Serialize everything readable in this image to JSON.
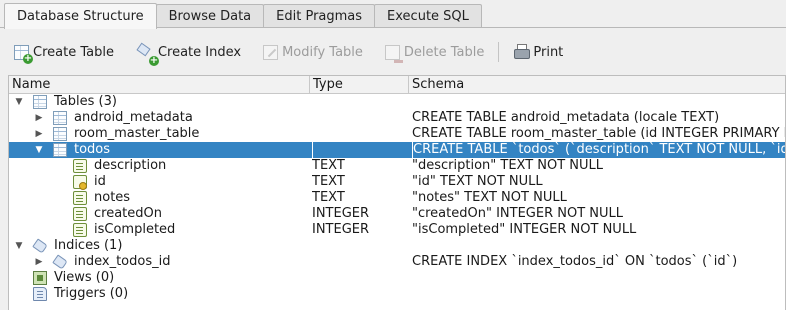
{
  "tabs": [
    {
      "label": "Database Structure",
      "active": true
    },
    {
      "label": "Browse Data",
      "active": false
    },
    {
      "label": "Edit Pragmas",
      "active": false
    },
    {
      "label": "Execute SQL",
      "active": false
    }
  ],
  "toolbar": {
    "create_table": "Create Table",
    "create_index": "Create Index",
    "modify_table": "Modify Table",
    "delete_table": "Delete Table",
    "print": "Print"
  },
  "columns": {
    "name": "Name",
    "type": "Type",
    "schema": "Schema"
  },
  "tree": {
    "tables": {
      "label": "Tables (3)"
    },
    "android_metadata": {
      "name": "android_metadata",
      "schema": "CREATE TABLE android_metadata (locale TEXT)"
    },
    "room_master_table": {
      "name": "room_master_table",
      "schema": "CREATE TABLE room_master_table (id INTEGER PRIMARY KEY,identity_hash TEXT)"
    },
    "todos": {
      "name": "todos",
      "schema": "CREATE TABLE `todos` (`description` TEXT NOT NULL, `id` TEXT NOT NULL"
    },
    "fields": [
      {
        "name": "description",
        "type": "TEXT",
        "schema": "\"description\" TEXT NOT NULL",
        "key": false
      },
      {
        "name": "id",
        "type": "TEXT",
        "schema": "\"id\" TEXT NOT NULL",
        "key": true
      },
      {
        "name": "notes",
        "type": "TEXT",
        "schema": "\"notes\" TEXT NOT NULL",
        "key": false
      },
      {
        "name": "createdOn",
        "type": "INTEGER",
        "schema": "\"createdOn\" INTEGER NOT NULL",
        "key": false
      },
      {
        "name": "isCompleted",
        "type": "INTEGER",
        "schema": "\"isCompleted\" INTEGER NOT NULL",
        "key": false
      }
    ],
    "indices": {
      "label": "Indices (1)"
    },
    "index_todos_id": {
      "name": "index_todos_id",
      "schema": "CREATE INDEX `index_todos_id` ON `todos` (`id`)"
    },
    "views": {
      "label": "Views (0)"
    },
    "triggers": {
      "label": "Triggers (0)"
    }
  },
  "colors": {
    "selection": "#3484c3",
    "tree_bg": "#ffffff",
    "window_bg": "#efefef"
  }
}
